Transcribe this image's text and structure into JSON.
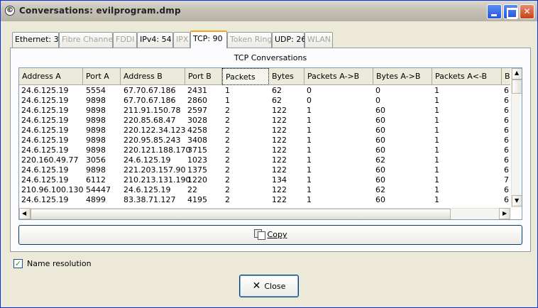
{
  "window": {
    "title": "Conversations: evilprogram.dmp",
    "app_icon": "©"
  },
  "tabs": [
    {
      "label": "Ethernet: 3",
      "disabled": false,
      "active": false
    },
    {
      "label": "Fibre Channel",
      "disabled": true,
      "active": false
    },
    {
      "label": "FDDI",
      "disabled": true,
      "active": false
    },
    {
      "label": "IPv4: 54",
      "disabled": false,
      "active": false
    },
    {
      "label": "IPX",
      "disabled": true,
      "active": false
    },
    {
      "label": "TCP: 90",
      "disabled": false,
      "active": true
    },
    {
      "label": "Token Ring",
      "disabled": true,
      "active": false
    },
    {
      "label": "UDP: 26",
      "disabled": false,
      "active": false
    },
    {
      "label": "WLAN",
      "disabled": true,
      "active": false
    }
  ],
  "panel_title": "TCP Conversations",
  "table": {
    "columns": [
      "Address A",
      "Port A",
      "Address B",
      "Port B",
      "Packets",
      "Bytes",
      "Packets A->B",
      "Bytes A->B",
      "Packets A<-B",
      "B"
    ],
    "sorted_column": "Packets",
    "rows": [
      [
        "24.6.125.19",
        "5554",
        "67.70.67.186",
        "2431",
        "1",
        "62",
        "0",
        "0",
        "1",
        "6"
      ],
      [
        "24.6.125.19",
        "9898",
        "67.70.67.186",
        "2860",
        "1",
        "62",
        "0",
        "0",
        "1",
        "6"
      ],
      [
        "24.6.125.19",
        "9898",
        "211.91.150.78",
        "2597",
        "2",
        "122",
        "1",
        "60",
        "1",
        "6"
      ],
      [
        "24.6.125.19",
        "9898",
        "220.85.68.47",
        "3028",
        "2",
        "122",
        "1",
        "60",
        "1",
        "6"
      ],
      [
        "24.6.125.19",
        "9898",
        "220.122.34.123",
        "4258",
        "2",
        "122",
        "1",
        "60",
        "1",
        "6"
      ],
      [
        "24.6.125.19",
        "9898",
        "220.95.85.243",
        "3408",
        "2",
        "122",
        "1",
        "60",
        "1",
        "6"
      ],
      [
        "24.6.125.19",
        "9898",
        "220.121.188.170",
        "3715",
        "2",
        "122",
        "1",
        "60",
        "1",
        "6"
      ],
      [
        "220.160.49.77",
        "3056",
        "24.6.125.19",
        "1023",
        "2",
        "122",
        "1",
        "62",
        "1",
        "6"
      ],
      [
        "24.6.125.19",
        "9898",
        "221.203.157.90",
        "1375",
        "2",
        "122",
        "1",
        "60",
        "1",
        "6"
      ],
      [
        "24.6.125.19",
        "6112",
        "210.213.131.190",
        "1220",
        "2",
        "134",
        "1",
        "60",
        "1",
        "7"
      ],
      [
        "210.96.100.130",
        "54447",
        "24.6.125.19",
        "22",
        "2",
        "122",
        "1",
        "62",
        "1",
        "6"
      ],
      [
        "24.6.125.19",
        "4899",
        "83.38.71.127",
        "4195",
        "2",
        "122",
        "1",
        "60",
        "1",
        "6"
      ]
    ]
  },
  "copy_label": "Copy",
  "name_resolution": {
    "label": "Name resolution",
    "checked": true,
    "check_glyph": "✓"
  },
  "close_label": "Close",
  "close_glyph": "✕",
  "scroll": {
    "up": "▲",
    "down": "▼",
    "left": "◀",
    "right": "▶"
  },
  "colors": {
    "accent_tab": "#f3a51c",
    "title_buttons": "#2457dc",
    "close_title_button": "#c8411b"
  }
}
